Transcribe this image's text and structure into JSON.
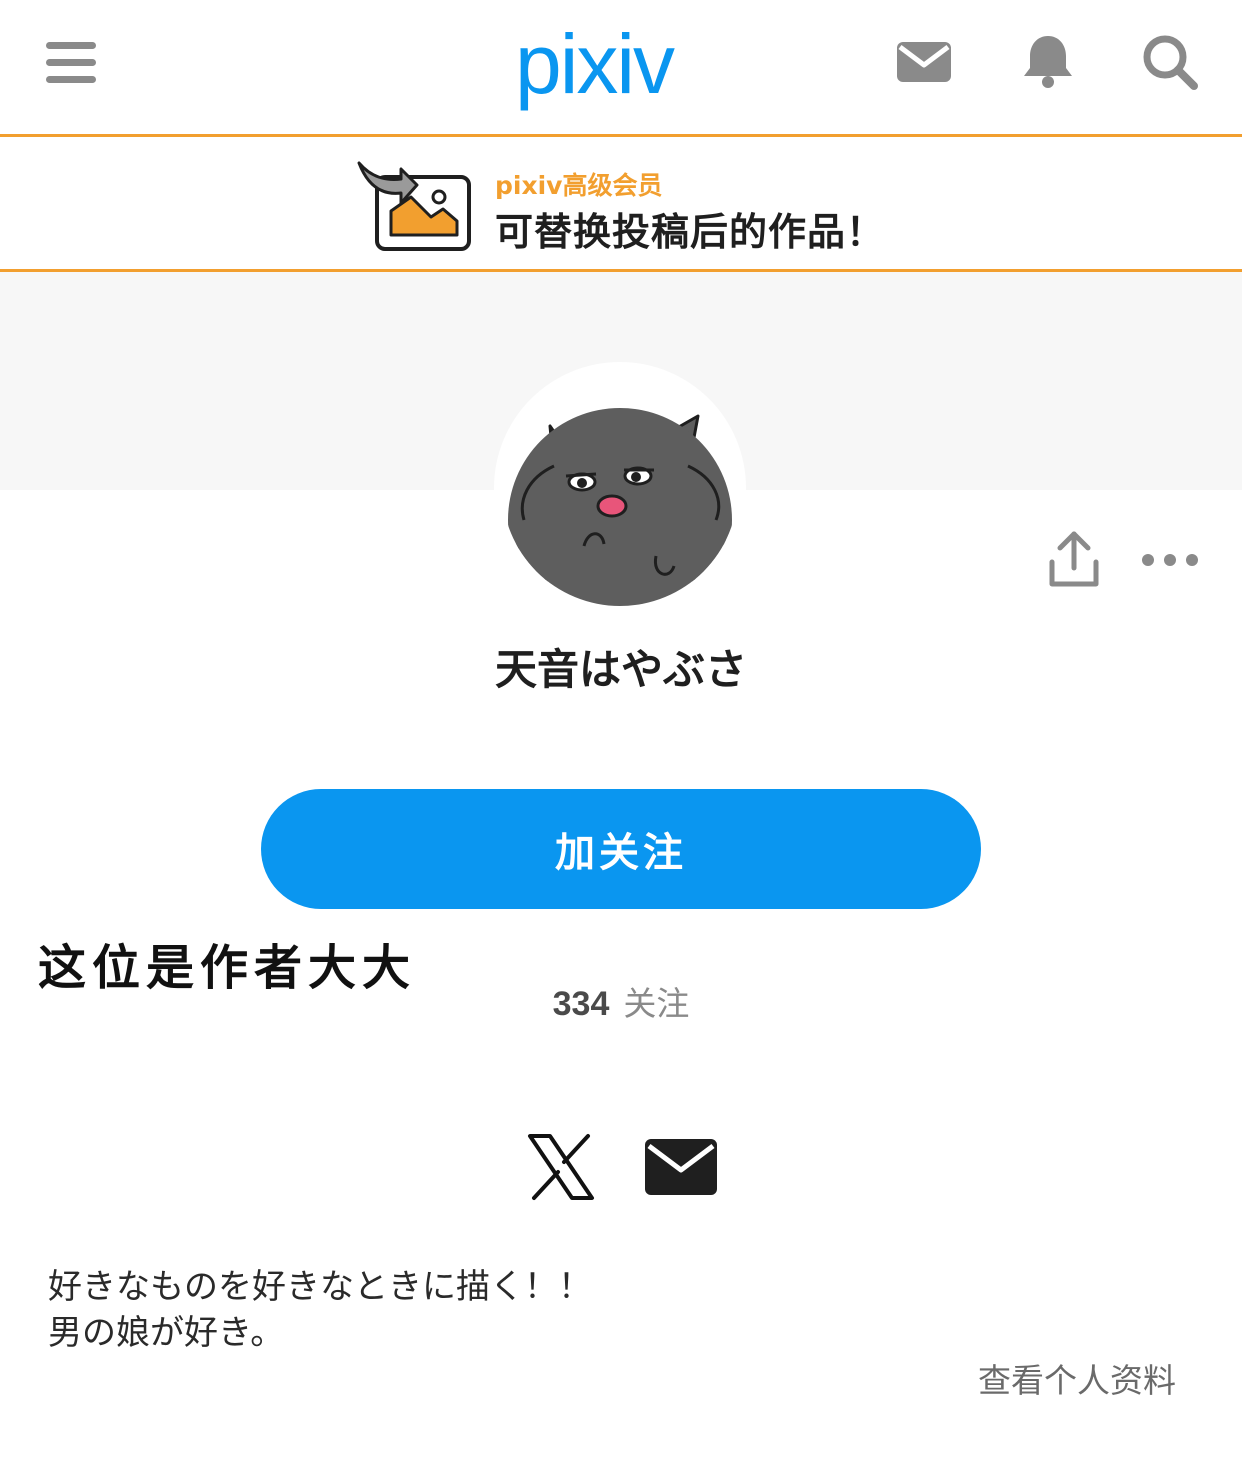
{
  "header": {
    "logo_text": "pixiv",
    "brand_color": "#0a96f0",
    "icons": [
      "menu-icon",
      "mail-icon",
      "bell-icon",
      "search-icon"
    ]
  },
  "banner": {
    "subtitle": "pixiv高级会员",
    "title": "可替换投稿后的作品！",
    "accent_color": "#f29f2f"
  },
  "profile": {
    "username": "天音はやぶさ",
    "follow_button": "加关注",
    "overlay_caption": "这位是作者大大",
    "following_count": "334",
    "following_label": "关注",
    "social": [
      "x-icon",
      "mail-icon"
    ],
    "bio_lines": [
      "好きなものを好きなときに描く！！",
      "男の娘が好き。"
    ],
    "view_profile_link": "查看个人资料"
  }
}
